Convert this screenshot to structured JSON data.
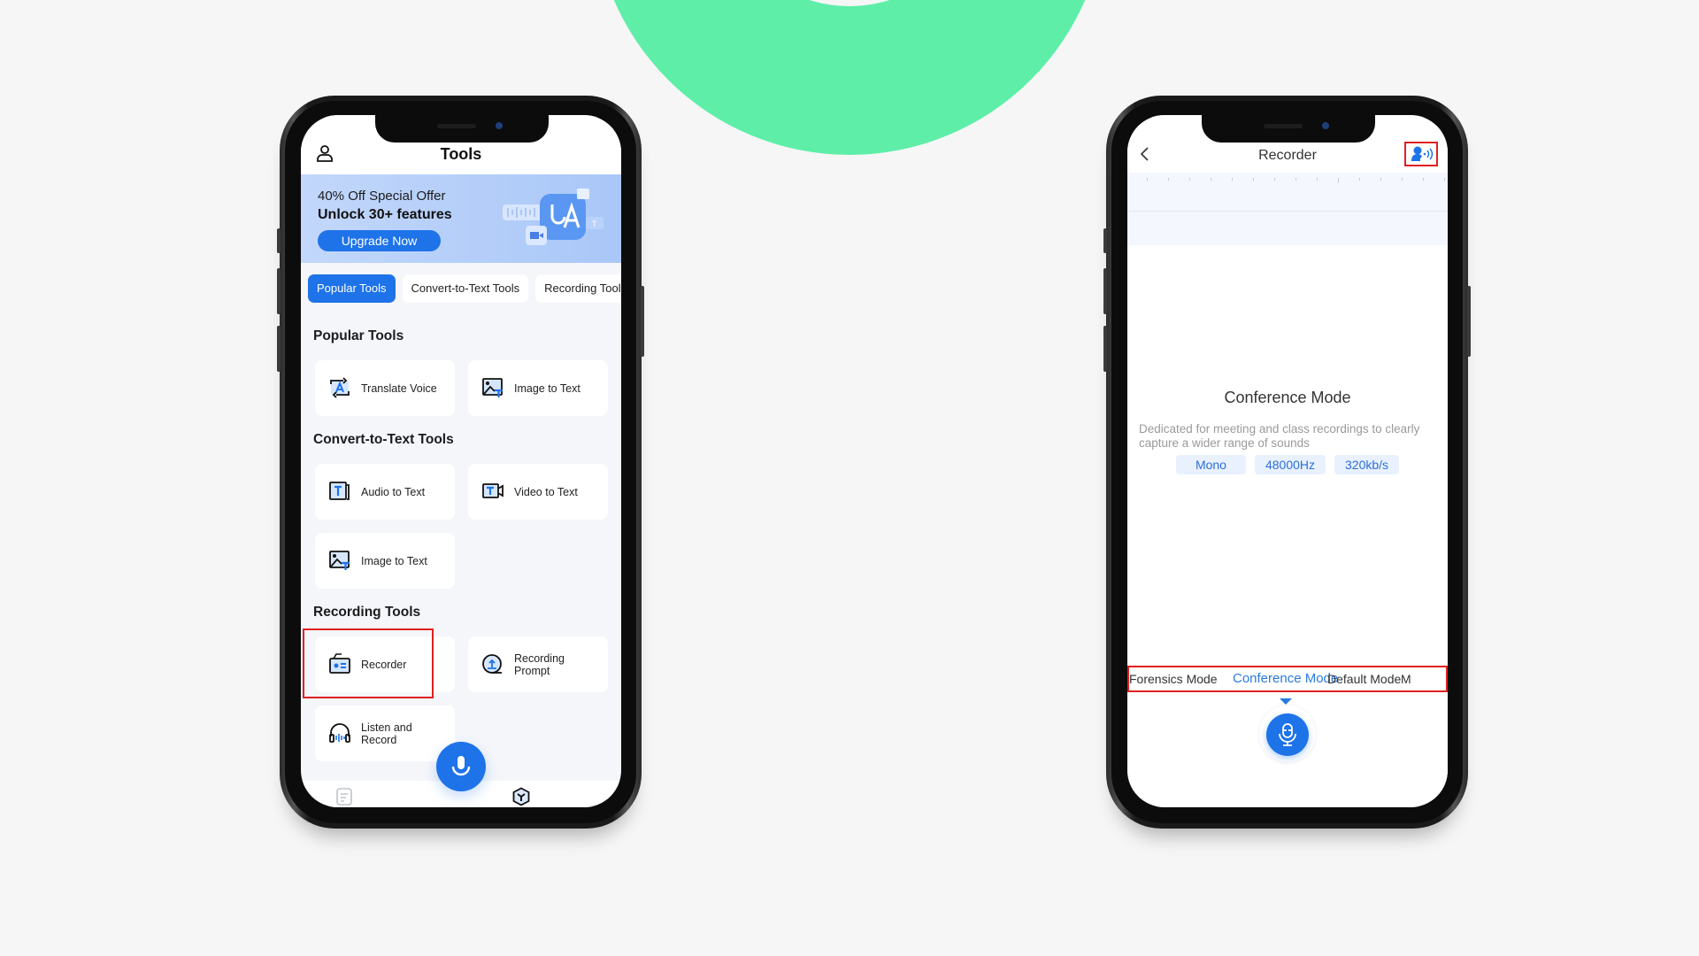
{
  "background": {
    "accent_color": "#5eeea8"
  },
  "phone_tools": {
    "header": {
      "title": "Tools",
      "profile_icon": "user-icon"
    },
    "banner": {
      "offer": "40% Off Special Offer",
      "headline": "Unlock 30+ features",
      "button_label": "Upgrade Now"
    },
    "tabs": [
      {
        "label": "Popular Tools",
        "active": true
      },
      {
        "label": "Convert-to-Text Tools",
        "active": false
      },
      {
        "label": "Recording Tools",
        "active": false
      }
    ],
    "sections": [
      {
        "heading": "Popular Tools",
        "items": [
          {
            "label": "Translate Voice",
            "icon": "translate-icon"
          },
          {
            "label": "Image to Text",
            "icon": "image-text-icon"
          }
        ]
      },
      {
        "heading": "Convert-to-Text Tools",
        "items": [
          {
            "label": "Audio to Text",
            "icon": "audio-text-icon"
          },
          {
            "label": "Video to Text",
            "icon": "video-text-icon"
          },
          {
            "label": "Image to Text",
            "icon": "image-text-icon"
          }
        ]
      },
      {
        "heading": "Recording Tools",
        "items": [
          {
            "label": "Recorder",
            "icon": "recorder-icon",
            "highlighted": true
          },
          {
            "label": "Recording Prompt",
            "icon": "teleprompter-icon"
          },
          {
            "label": "Listen and Record",
            "icon": "headphones-icon"
          }
        ]
      }
    ],
    "bottom_nav": [
      {
        "icon": "notes-icon",
        "active": false
      },
      {
        "icon": "tools-icon",
        "active": true
      }
    ],
    "fab_icon": "microphone-icon",
    "brand_color": "#1e73e8"
  },
  "phone_recorder": {
    "header": {
      "title": "Recorder",
      "back_icon": "chevron-left-icon",
      "action_icon": "speaker-voice-icon"
    },
    "mode": {
      "title": "Conference Mode",
      "description": "Dedicated for meeting and class recordings to clearly capture a wider range of sounds",
      "specs": [
        "Mono",
        "48000Hz",
        "320kb/s"
      ]
    },
    "mode_selector": [
      {
        "label": "Forensics Mode",
        "active": false
      },
      {
        "label": "Conference Mode",
        "active": true
      },
      {
        "label": "Default Mode",
        "active": false
      },
      {
        "label": "M",
        "active": false
      }
    ],
    "record_icon": "microphone-icon",
    "highlight_color": "#e02020"
  }
}
